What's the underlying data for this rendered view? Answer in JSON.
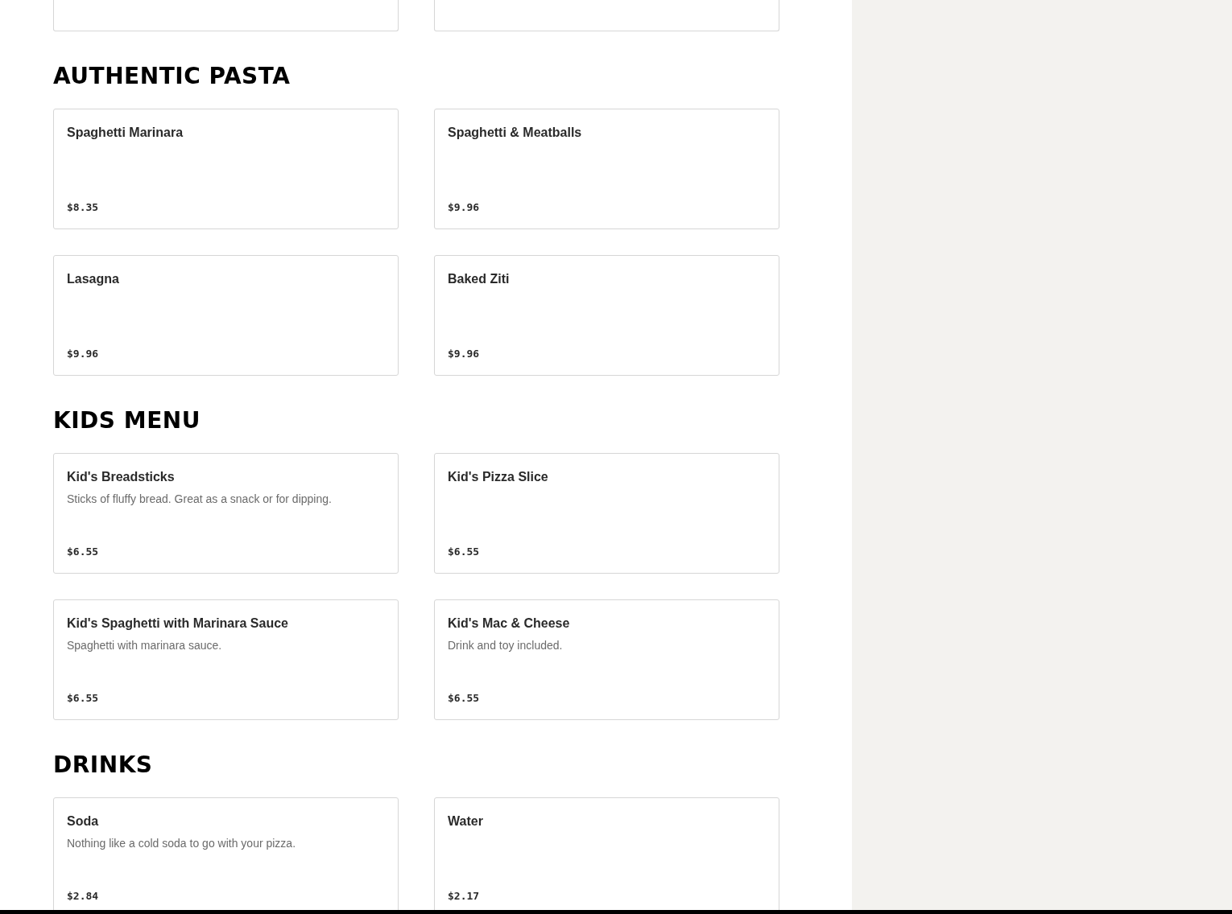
{
  "sections": [
    {
      "title": "AUTHENTIC PASTA",
      "items": [
        {
          "name": "Spaghetti Marinara",
          "price": "$8.35"
        },
        {
          "name": "Spaghetti & Meatballs",
          "price": "$9.96"
        },
        {
          "name": "Lasagna",
          "price": "$9.96"
        },
        {
          "name": "Baked Ziti",
          "price": "$9.96"
        }
      ]
    },
    {
      "title": "KIDS MENU",
      "items": [
        {
          "name": "Kid's Breadsticks",
          "description": "Sticks of fluffy bread. Great as a snack or for dipping.",
          "price": "$6.55"
        },
        {
          "name": "Kid's Pizza Slice",
          "price": "$6.55"
        },
        {
          "name": "Kid's Spaghetti with Marinara Sauce",
          "description": "Spaghetti with marinara sauce.",
          "price": "$6.55"
        },
        {
          "name": "Kid's Mac & Cheese",
          "description": "Drink and toy included.",
          "price": "$6.55"
        }
      ]
    },
    {
      "title": "DRINKS",
      "items": [
        {
          "name": "Soda",
          "description": "Nothing like a cold soda to go with your pizza.",
          "price": "$2.84"
        },
        {
          "name": "Water",
          "price": "$2.17"
        }
      ]
    }
  ]
}
